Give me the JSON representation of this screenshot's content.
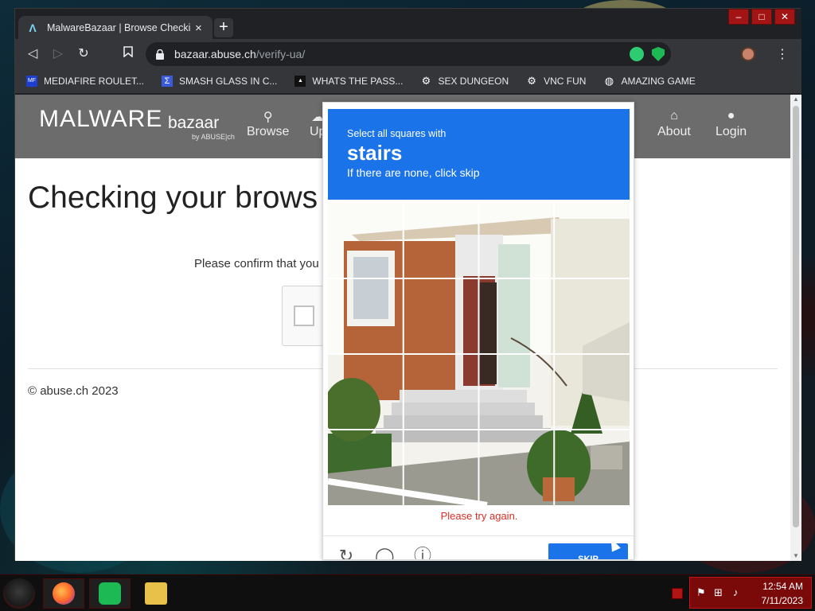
{
  "browser": {
    "tab_title": "MalwareBazaar | Browse Checking",
    "tab_close": "×",
    "new_tab": "+",
    "url_host": "bazaar.abuse.ch",
    "url_path": "/verify-ua/",
    "window_controls": [
      "–",
      "□",
      "✕"
    ],
    "back_glyph": "◁",
    "forward_glyph": "▷",
    "reload_glyph": "↻",
    "menu_glyph": "⋮"
  },
  "bookmarks": [
    {
      "label": "MEDIAFIRE ROULET...",
      "icon": "mediafire-icon",
      "badge": "MF"
    },
    {
      "label": "SMASH GLASS IN C...",
      "icon": "sigma-icon",
      "badge": "Σ"
    },
    {
      "label": "WHATS THE PASS...",
      "icon": "lock-bookmark-icon",
      "badge": "▲"
    },
    {
      "label": "SEX DUNGEON",
      "icon": "settings-bookmark-icon",
      "badge": "⚙"
    },
    {
      "label": "VNC FUN",
      "icon": "settings-bookmark-icon",
      "badge": "⚙"
    },
    {
      "label": "AMAZING GAME",
      "icon": "globe-icon",
      "badge": "◍"
    }
  ],
  "site": {
    "logo_main": "MALWARE",
    "logo_sub": "bazaar",
    "logo_by": "by ABUSE|ch",
    "nav": [
      {
        "label": "Browse",
        "icon": "search-icon",
        "glyph": "⚲"
      },
      {
        "label": "Up",
        "icon": "upload-icon",
        "glyph": "☁"
      },
      {
        "label": "About",
        "icon": "bank-icon",
        "glyph": "⌂"
      },
      {
        "label": "Login",
        "icon": "user-icon",
        "glyph": "●"
      }
    ],
    "heading": "Checking your brows",
    "confirm_text": "Please confirm that you",
    "footer": "© abuse.ch 2023"
  },
  "captcha": {
    "prompt": "Select all squares with",
    "keyword": "stairs",
    "hint": "If there are none, click skip",
    "error": "Please try again.",
    "skip_label": "SKIP",
    "controls": [
      {
        "name": "refresh-icon",
        "glyph": "↻"
      },
      {
        "name": "audio-icon",
        "glyph": "◯"
      },
      {
        "name": "info-icon",
        "glyph": "ⓘ"
      }
    ]
  },
  "taskbar": {
    "time": "12:54 AM",
    "date": "7/11/2023",
    "tray_icons": [
      "flag-icon",
      "network-icon",
      "volume-icon"
    ]
  },
  "colors": {
    "captcha_blue": "#1a73e8",
    "error_red": "#d93025",
    "site_header": "#6c6c6c",
    "taskbar_red": "#7a0a0a"
  }
}
